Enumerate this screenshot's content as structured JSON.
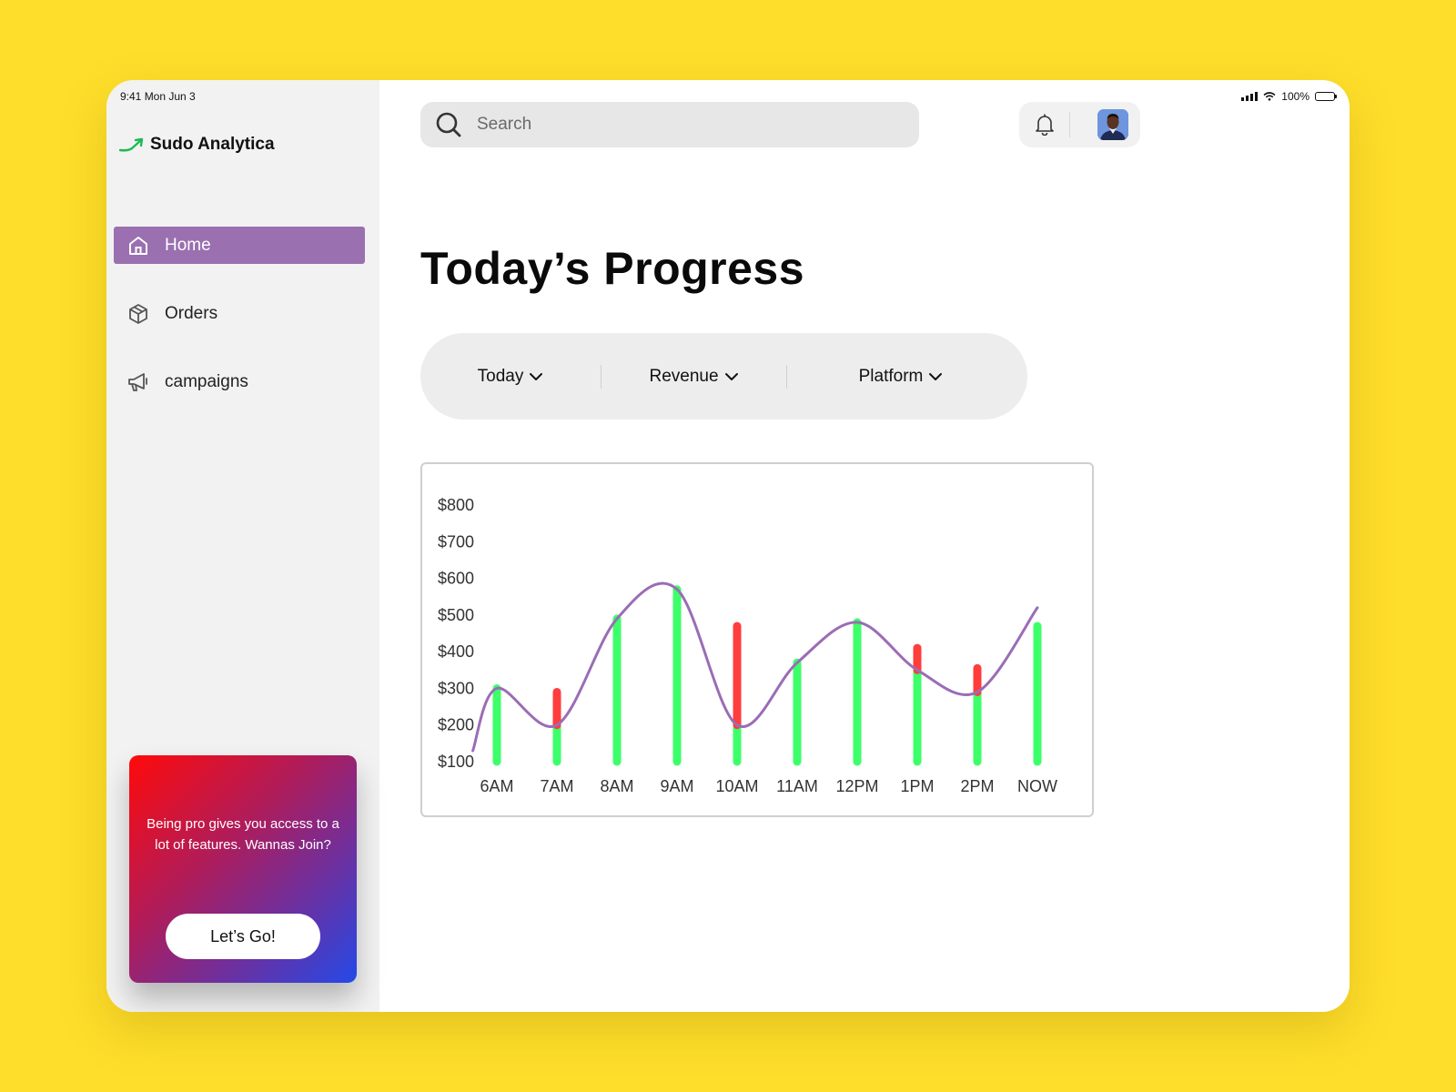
{
  "status_bar": {
    "time_date": "9:41  Mon Jun 3",
    "battery": "100%"
  },
  "brand": {
    "name": "Sudo Analytica",
    "logo_icon": "trend-up-arrow-icon",
    "logo_color": "#1DB954"
  },
  "sidebar": {
    "items": [
      {
        "label": "Home",
        "icon": "home-icon",
        "active": true
      },
      {
        "label": "Orders",
        "icon": "package-icon",
        "active": false
      },
      {
        "label": "campaigns",
        "icon": "megaphone-icon",
        "active": false
      }
    ],
    "active_color": "#9A70B0"
  },
  "promo": {
    "text": "Being pro gives you access to a lot of features. Wannas Join?",
    "button_label": "Let’s Go!"
  },
  "search": {
    "placeholder": "Search"
  },
  "header": {
    "notification_icon": "bell-icon",
    "avatar_icon": "user-avatar"
  },
  "page": {
    "title": "Today’s Progress"
  },
  "filters": [
    {
      "label": "Today",
      "icon": "chevron-down-icon"
    },
    {
      "label": "Revenue",
      "icon": "chevron-down-icon"
    },
    {
      "label": "Platform",
      "icon": "chevron-down-icon"
    }
  ],
  "chart_data": {
    "type": "bar",
    "title": "",
    "xlabel": "",
    "ylabel": "",
    "ylim": [
      100,
      800
    ],
    "y_ticks": [
      "$800",
      "$700",
      "$600",
      "$500",
      "$400",
      "$300",
      "$200",
      "$100"
    ],
    "y_tick_values": [
      800,
      700,
      600,
      500,
      400,
      300,
      200,
      100
    ],
    "categories": [
      "6AM",
      "7AM",
      "8AM",
      "9AM",
      "10AM",
      "11AM",
      "12PM",
      "1PM",
      "2PM",
      "NOW"
    ],
    "bars": [
      {
        "low": 100,
        "high": 300,
        "decrease_from": null
      },
      {
        "low": 100,
        "high": 290,
        "decrease_from": 200
      },
      {
        "low": 100,
        "high": 490,
        "decrease_from": null
      },
      {
        "low": 100,
        "high": 570,
        "decrease_from": null
      },
      {
        "low": 100,
        "high": 470,
        "decrease_from": 200
      },
      {
        "low": 100,
        "high": 370,
        "decrease_from": null
      },
      {
        "low": 100,
        "high": 480,
        "decrease_from": null
      },
      {
        "low": 100,
        "high": 410,
        "decrease_from": 350
      },
      {
        "low": 100,
        "high": 355,
        "decrease_from": 290
      },
      {
        "low": 100,
        "high": 470,
        "decrease_from": null
      }
    ],
    "trend_line": [
      {
        "x": 5.6,
        "y": 130
      },
      {
        "x": 6,
        "y": 300
      },
      {
        "x": 7,
        "y": 200
      },
      {
        "x": 8,
        "y": 490
      },
      {
        "x": 9,
        "y": 570
      },
      {
        "x": 10,
        "y": 200
      },
      {
        "x": 11,
        "y": 370
      },
      {
        "x": 12,
        "y": 480
      },
      {
        "x": 13,
        "y": 350
      },
      {
        "x": 14,
        "y": 290
      },
      {
        "x": 15,
        "y": 520
      }
    ],
    "colors": {
      "increase": "#3DFF6A",
      "decrease": "#FF3D3D",
      "trend": "#9A6DB5"
    }
  }
}
